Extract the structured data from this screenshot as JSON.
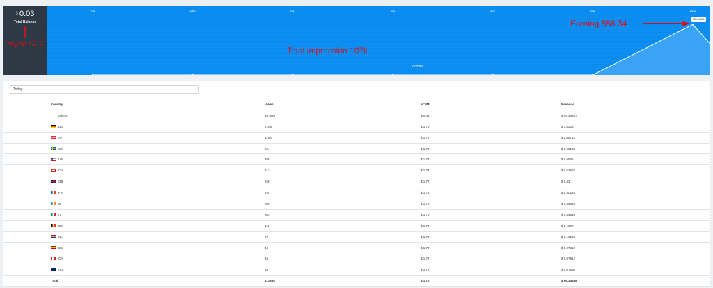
{
  "balance": {
    "currency": "$",
    "amount": "0.03",
    "label": "Total Balance"
  },
  "chart_data": {
    "type": "area",
    "x": [
      "TUE",
      "WED",
      "THU",
      "FRI",
      "SAT",
      "SUN",
      "MON"
    ],
    "series": [
      {
        "values": [
          0,
          0,
          0,
          0,
          0,
          0,
          56.34
        ]
      }
    ],
    "xlabel": "Income",
    "tooltip": "$56.34849",
    "colors": {
      "background": "#0a8cf0",
      "area": "#3aa3f5",
      "line": "#ffffff"
    }
  },
  "annotations": {
    "payed": "Payed $7.7",
    "impressions": "Total impression 107k",
    "earning": "Earning $56.34"
  },
  "filter": {
    "selected": "Today",
    "icon": "chevron-down-icon"
  },
  "table": {
    "headers": {
      "country": "Country",
      "views": "Views",
      "ecpm": "eCPM",
      "revenue": "Revenue"
    },
    "rows": [
      {
        "flag": "",
        "country": "others",
        "views": "107899",
        "ecpm": "$ 0.43",
        "revenue": "$ 46.39657"
      },
      {
        "flag": "de",
        "country": "DE",
        "views": "2105",
        "ecpm": "$ 1.72",
        "revenue": "$ 3.6206"
      },
      {
        "flag": "at",
        "country": "AT",
        "views": "1196",
        "ecpm": "$ 1.72",
        "revenue": "$ 2.05712"
      },
      {
        "flag": "se",
        "country": "SE",
        "views": "524",
        "ecpm": "$ 1.72",
        "revenue": "$ 0.90128"
      },
      {
        "flag": "us",
        "country": "US",
        "views": "405",
        "ecpm": "$ 1.72",
        "revenue": "$ 0.6966"
      },
      {
        "flag": "ch",
        "country": "CH",
        "views": "312",
        "ecpm": "$ 1.72",
        "revenue": "$ 0.53664"
      },
      {
        "flag": "gb",
        "country": "GB",
        "views": "250",
        "ecpm": "$ 1.72",
        "revenue": "$ 0.43"
      },
      {
        "flag": "fr",
        "country": "FR",
        "views": "234",
        "ecpm": "$ 1.72",
        "revenue": "$ 0.40248"
      },
      {
        "flag": "ie",
        "country": "IE",
        "views": "209",
        "ecpm": "$ 1.72",
        "revenue": "$ 0.35948"
      },
      {
        "flag": "it",
        "country": "IT",
        "views": "203",
        "ecpm": "$ 1.72",
        "revenue": "$ 0.34916"
      },
      {
        "flag": "be",
        "country": "BE",
        "views": "115",
        "ecpm": "$ 1.72",
        "revenue": "$ 0.1978"
      },
      {
        "flag": "nl",
        "country": "NL",
        "views": "97",
        "ecpm": "$ 1.72",
        "revenue": "$ 0.16684"
      },
      {
        "flag": "es",
        "country": "ES",
        "views": "46",
        "ecpm": "$ 1.72",
        "revenue": "$ 0.07912"
      },
      {
        "flag": "ca",
        "country": "CA",
        "views": "46",
        "ecpm": "$ 1.72",
        "revenue": "$ 0.07912"
      },
      {
        "flag": "au",
        "country": "AU",
        "views": "44",
        "ecpm": "$ 1.72",
        "revenue": "$ 0.07568"
      }
    ],
    "total": {
      "label": "Total",
      "views": "113685",
      "ecpm": "$ 1.72",
      "revenue": "$ 56.34849"
    }
  }
}
